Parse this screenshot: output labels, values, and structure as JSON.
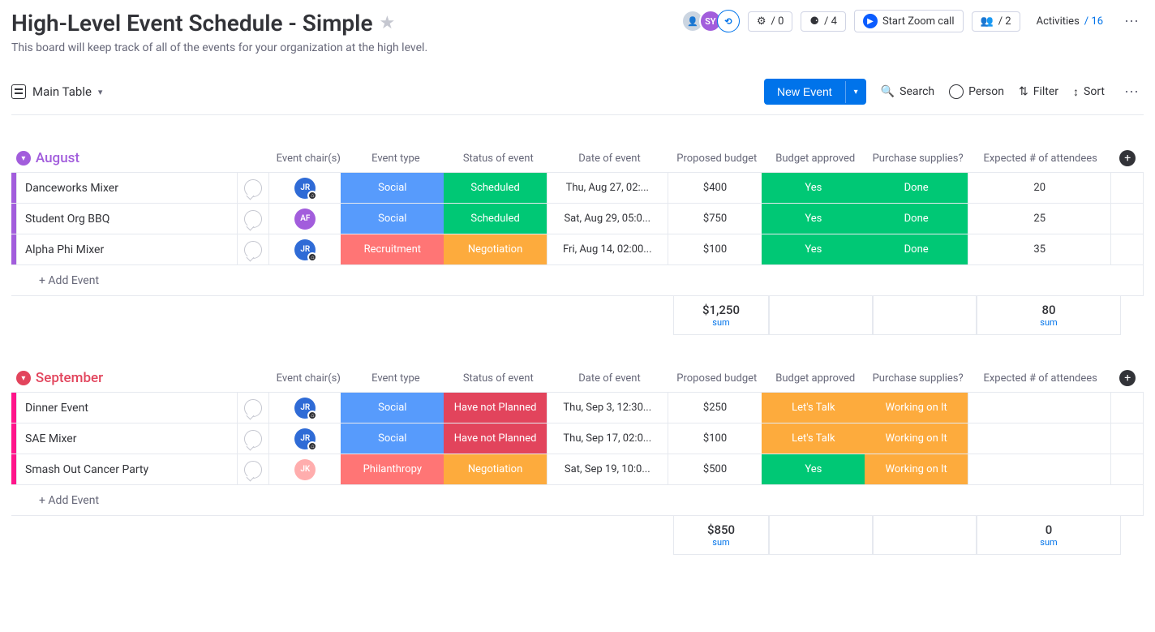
{
  "header": {
    "title": "High-Level Event Schedule - Simple",
    "description": "This board will keep track of all of the events for your organization at the high level.",
    "integrations_count": "/ 0",
    "automations_count": "/ 4",
    "zoom_label": "Start Zoom call",
    "members_count": "/ 2",
    "activities_label": "Activities",
    "activities_count": "/ 16"
  },
  "views": {
    "main_tab": "Main Table"
  },
  "toolbar": {
    "new_event": "New Event",
    "search": "Search",
    "person": "Person",
    "filter": "Filter",
    "sort": "Sort"
  },
  "columns": {
    "chair": "Event chair(s)",
    "type": "Event type",
    "status": "Status of event",
    "date": "Date of event",
    "budget": "Proposed budget",
    "approved": "Budget approved",
    "supplies": "Purchase supplies?",
    "attendees": "Expected # of attendees"
  },
  "addEvent": "+ Add Event",
  "sumLabel": "sum",
  "groups": [
    {
      "name": "August",
      "color": "aug",
      "rows": [
        {
          "name": "Danceworks Mixer",
          "chair": "JR",
          "chairClass": "chair-jr",
          "chairDot": true,
          "type": "Social",
          "typeClass": "c-social",
          "status": "Scheduled",
          "statusClass": "c-scheduled",
          "date": "Thu, Aug 27, 02:...",
          "budget": "$400",
          "approved": "Yes",
          "approvedClass": "c-yes",
          "supplies": "Done",
          "suppliesClass": "c-done",
          "attendees": "20"
        },
        {
          "name": "Student Org BBQ",
          "chair": "AF",
          "chairClass": "chair-af",
          "chairDot": false,
          "type": "Social",
          "typeClass": "c-social",
          "status": "Scheduled",
          "statusClass": "c-scheduled",
          "date": "Sat, Aug 29, 05:0...",
          "budget": "$750",
          "approved": "Yes",
          "approvedClass": "c-yes",
          "supplies": "Done",
          "suppliesClass": "c-done",
          "attendees": "25"
        },
        {
          "name": "Alpha Phi Mixer",
          "chair": "JR",
          "chairClass": "chair-jr",
          "chairDot": true,
          "type": "Recruitment",
          "typeClass": "c-recruit",
          "status": "Negotiation",
          "statusClass": "c-negot",
          "date": "Fri, Aug 14, 02:00...",
          "budget": "$100",
          "approved": "Yes",
          "approvedClass": "c-yes",
          "supplies": "Done",
          "suppliesClass": "c-done",
          "attendees": "35"
        }
      ],
      "sumBudget": "$1,250",
      "sumAttendees": "80"
    },
    {
      "name": "September",
      "color": "sep",
      "rows": [
        {
          "name": "Dinner Event",
          "chair": "JR",
          "chairClass": "chair-jr",
          "chairDot": true,
          "type": "Social",
          "typeClass": "c-social",
          "status": "Have not Planned",
          "statusClass": "c-notplanned",
          "date": "Thu, Sep 3, 12:30...",
          "budget": "$250",
          "approved": "Let's Talk",
          "approvedClass": "c-letstalk",
          "supplies": "Working on It",
          "suppliesClass": "c-working",
          "attendees": ""
        },
        {
          "name": "SAE Mixer",
          "chair": "JR",
          "chairClass": "chair-jr",
          "chairDot": true,
          "type": "Social",
          "typeClass": "c-social",
          "status": "Have not Planned",
          "statusClass": "c-notplanned",
          "date": "Thu, Sep 17, 02:0...",
          "budget": "$100",
          "approved": "Let's Talk",
          "approvedClass": "c-letstalk",
          "supplies": "Working on It",
          "suppliesClass": "c-working",
          "attendees": ""
        },
        {
          "name": "Smash Out Cancer Party",
          "chair": "JK",
          "chairClass": "chair-jk",
          "chairDot": false,
          "type": "Philanthropy",
          "typeClass": "c-phil",
          "status": "Negotiation",
          "statusClass": "c-negot",
          "date": "Sat, Sep 19, 10:0...",
          "budget": "$500",
          "approved": "Yes",
          "approvedClass": "c-yes",
          "supplies": "Working on It",
          "suppliesClass": "c-working",
          "attendees": ""
        }
      ],
      "sumBudget": "$850",
      "sumAttendees": "0"
    }
  ]
}
